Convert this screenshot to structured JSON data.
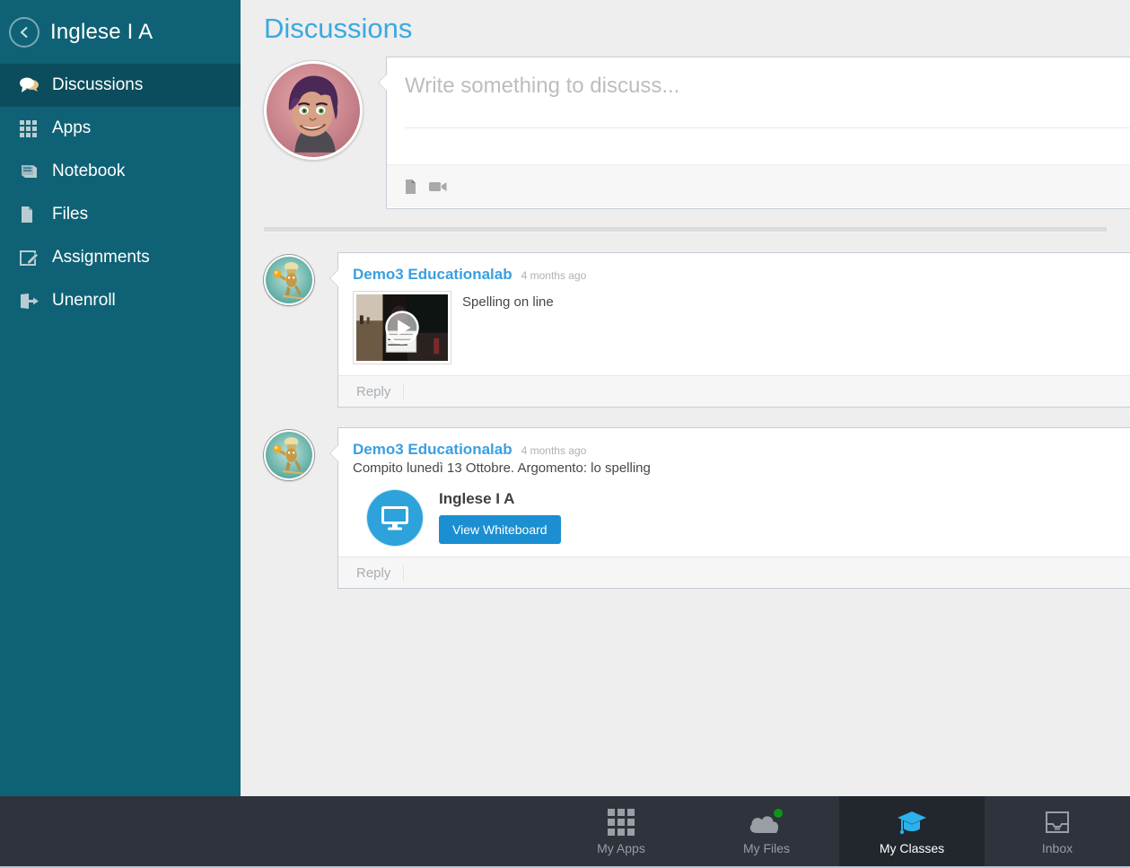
{
  "sidebar": {
    "back_icon": "chevron-left-circle-icon",
    "course_title": "Inglese I A",
    "items": [
      {
        "label": "Discussions",
        "icon": "speech-bubbles-icon",
        "active": true
      },
      {
        "label": "Apps",
        "icon": "grid-icon",
        "active": false
      },
      {
        "label": "Notebook",
        "icon": "notebook-icon",
        "active": false
      },
      {
        "label": "Files",
        "icon": "file-icon",
        "active": false
      },
      {
        "label": "Assignments",
        "icon": "pencil-square-icon",
        "active": false
      },
      {
        "label": "Unenroll",
        "icon": "sign-out-icon",
        "active": false
      }
    ]
  },
  "main": {
    "page_title": "Discussions",
    "composer": {
      "avatar": "student-avatar",
      "placeholder": "Write something to discuss...",
      "tools": [
        {
          "icon": "attach-file-icon",
          "name": "attach-file"
        },
        {
          "icon": "video-camera-icon",
          "name": "record-video"
        }
      ]
    },
    "posts": [
      {
        "avatar": "teacher-avatar",
        "author": "Demo3 Educationalab",
        "timestamp": "4 months ago",
        "text": "",
        "media": {
          "type": "video",
          "caption": "Spelling on line",
          "play_icon": "play-icon"
        },
        "reply_label": "Reply"
      },
      {
        "avatar": "teacher-avatar",
        "author": "Demo3 Educationalab",
        "timestamp": "4 months ago",
        "text": "Compito lunedì 13 Ottobre. Argomento: lo spelling",
        "attachment": {
          "icon": "monitor-icon",
          "title": "Inglese I A",
          "button_label": "View Whiteboard"
        },
        "reply_label": "Reply"
      }
    ]
  },
  "bottom_nav": {
    "tabs": [
      {
        "label": "My Apps",
        "icon": "grid-icon",
        "active": false,
        "badge": false
      },
      {
        "label": "My Files",
        "icon": "cloud-icon",
        "active": false,
        "badge": true
      },
      {
        "label": "My Classes",
        "icon": "graduation-cap-icon",
        "active": true,
        "badge": false
      },
      {
        "label": "Inbox",
        "icon": "inbox-tray-icon",
        "active": false,
        "badge": false
      }
    ]
  },
  "colors": {
    "sidebar_bg": "#0f6275",
    "sidebar_active": "#0b4d5c",
    "accent_blue": "#3aa9e0",
    "button_blue": "#1b8fd1",
    "bottom_bar": "#2e333c",
    "bottom_active": "#22262d",
    "badge_green": "#0f9418",
    "page_bg": "#eeeeee"
  }
}
